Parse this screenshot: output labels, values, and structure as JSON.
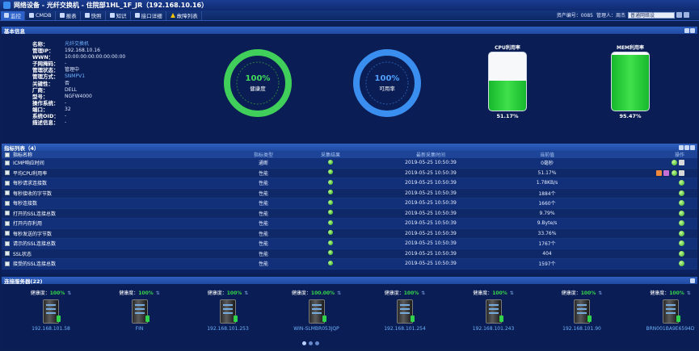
{
  "window": {
    "title": "网络设备 - 光纤交换机 - 住院部1HL_1F_JR（192.168.10.16）"
  },
  "toolbar": {
    "items": [
      {
        "label": "监控",
        "active": true,
        "icon": "monitor-icon"
      },
      {
        "label": "CMDB",
        "icon": "database-icon"
      },
      {
        "label": "报表",
        "icon": "chart-icon"
      },
      {
        "label": "快照",
        "icon": "snapshot-icon"
      },
      {
        "label": "知识",
        "icon": "book-icon"
      },
      {
        "label": "接口详细",
        "icon": "interface-icon"
      },
      {
        "label": "故障列表",
        "icon": "warning-icon"
      }
    ]
  },
  "header_right": {
    "asset": "资产编号：0085",
    "admin": "管理人：周杰",
    "network_select": "普通网络设"
  },
  "basic": {
    "section_title": "基本信息",
    "fields": [
      {
        "k": "名称：",
        "v": "光纤交换机",
        "blue": true
      },
      {
        "k": "管理IP：",
        "v": "192.168.10.16"
      },
      {
        "k": "WWN：",
        "v": "10:00:00:00:00:00:00:00"
      },
      {
        "k": "子网掩码：",
        "v": "-"
      },
      {
        "k": "管理状态：",
        "v": "管理中"
      },
      {
        "k": "管理方式：",
        "v": "SNMPV1",
        "blue": true
      },
      {
        "k": "关键性：",
        "v": "否"
      },
      {
        "k": "厂商：",
        "v": "DELL"
      },
      {
        "k": "型号：",
        "v": "NGFW4000"
      },
      {
        "k": "操作系统：",
        "v": "-"
      },
      {
        "k": "端口：",
        "v": "32"
      },
      {
        "k": "系统OID：",
        "v": "-"
      },
      {
        "k": "描述信息：",
        "v": "-"
      }
    ],
    "health": {
      "value": "100%",
      "label": "健康度",
      "percent": 100,
      "color": "#3fcf5a"
    },
    "availability": {
      "value": "100%",
      "label": "可用率",
      "percent": 100,
      "color": "#3a8ef0"
    },
    "cpu": {
      "title": "CPU利用率",
      "value": "51.17%",
      "percent": 51.17
    },
    "mem": {
      "title": "MEM利用率",
      "value": "95.47%",
      "percent": 95.47
    }
  },
  "index_list": {
    "section_title": "指标列表（4）",
    "columns": [
      "指标名称",
      "指标类型",
      "采集结果",
      "最新采集时间",
      "当前值",
      "操作"
    ],
    "rows": [
      {
        "name": "ICMP响应时间",
        "type": "通断",
        "time": "2019-05-25 10:50:39",
        "value": "0毫秒"
      },
      {
        "name": "平均CPU利用率",
        "type": "性能",
        "time": "2019-05-25 10:50:39",
        "value": "51.17%",
        "extra": true
      },
      {
        "name": "每秒请求连接数",
        "type": "性能",
        "time": "2019-05-25 10:50:39",
        "value": "1.78KB/s"
      },
      {
        "name": "每秒接收的字节数",
        "type": "性能",
        "time": "2019-05-25 10:50:39",
        "value": "1884个"
      },
      {
        "name": "每秒连接数",
        "type": "性能",
        "time": "2019-05-25 10:50:39",
        "value": "1660个"
      },
      {
        "name": "打开的SSL连接总数",
        "type": "性能",
        "time": "2019-05-25 10:50:39",
        "value": "9.79%"
      },
      {
        "name": "打开内存利用",
        "type": "性能",
        "time": "2019-05-25 10:50:39",
        "value": "9.Byte/s"
      },
      {
        "name": "每秒发送的字节数",
        "type": "性能",
        "time": "2019-05-25 10:50:39",
        "value": "33.76%"
      },
      {
        "name": "请示的SSL连接总数",
        "type": "性能",
        "time": "2019-05-25 10:50:39",
        "value": "1767个"
      },
      {
        "name": "SSL状态",
        "type": "性能",
        "time": "2019-05-25 10:50:39",
        "value": "404"
      },
      {
        "name": "接受的SSL连接总数",
        "type": "性能",
        "time": "2019-05-25 10:50:39",
        "value": "1597个"
      }
    ]
  },
  "servers": {
    "section_title": "连接服务器(22)",
    "health_label": "健康度：",
    "items": [
      {
        "health": "100%",
        "ip": "192.168.101.58"
      },
      {
        "health": "100%",
        "ip": "FIN"
      },
      {
        "health": "100%",
        "ip": "192.168.101.253"
      },
      {
        "health": "100.00%",
        "ip": "WIN-SLMBR053JQP"
      },
      {
        "health": "100%",
        "ip": "192.168.101.254"
      },
      {
        "health": "100%",
        "ip": "192.168.101.243"
      },
      {
        "health": "100%",
        "ip": "192.168.101.90"
      },
      {
        "health": "100%",
        "ip": "BRN001BA9E6594D"
      }
    ]
  }
}
